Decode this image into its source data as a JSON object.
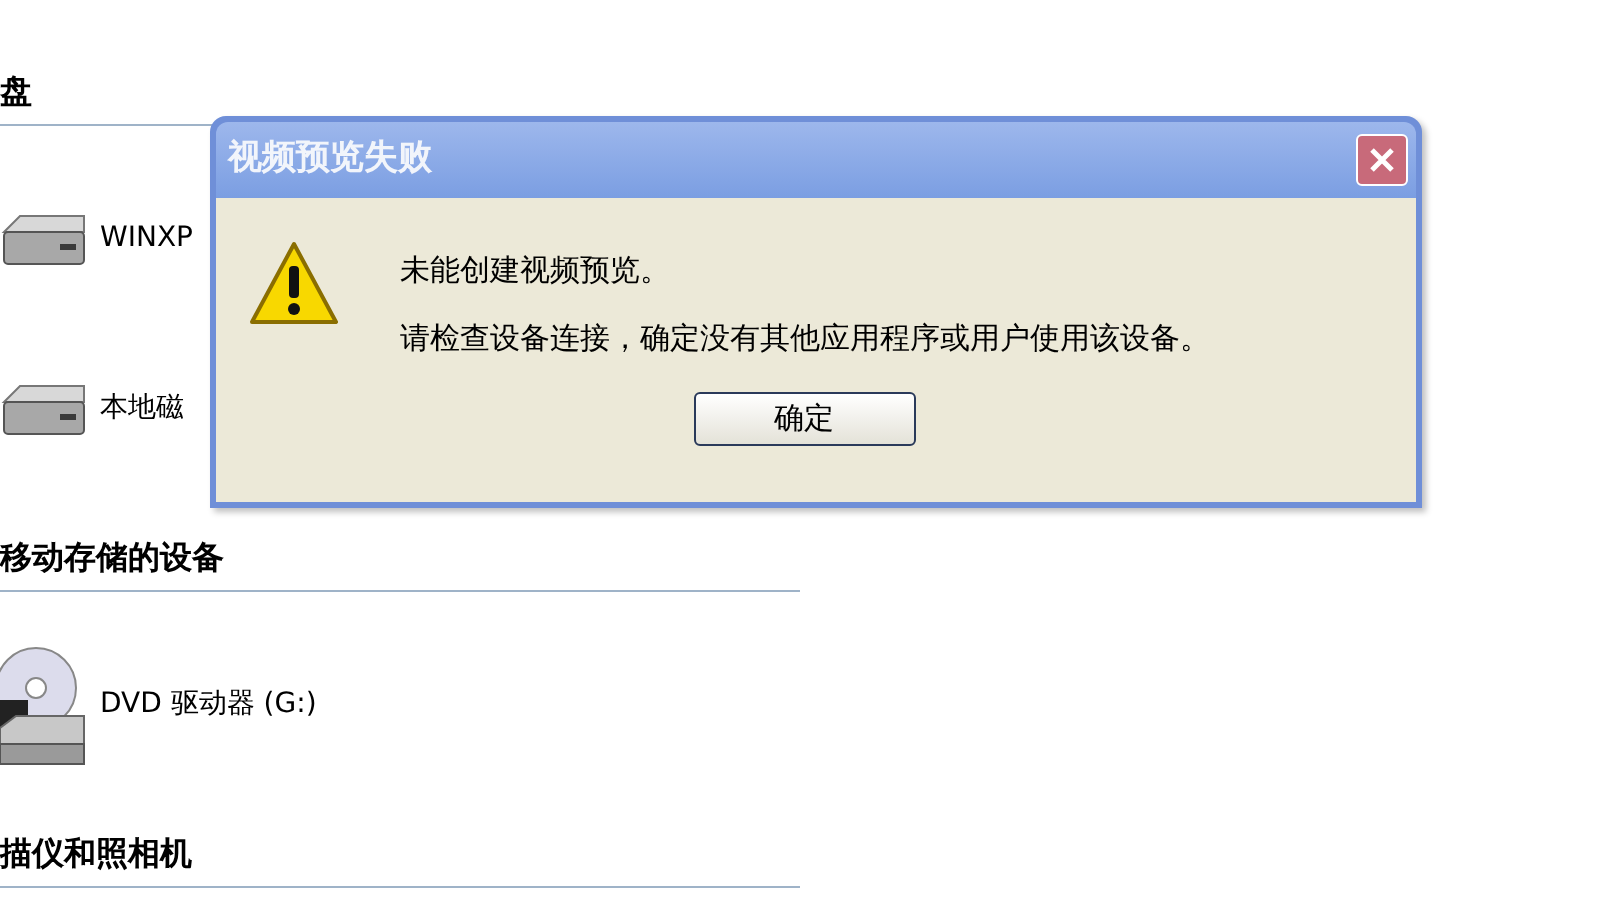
{
  "explorer": {
    "groups": [
      {
        "heading": "盘",
        "items": [
          {
            "kind": "disk",
            "label": "WINXP"
          },
          {
            "kind": "disk",
            "label": "本地磁"
          }
        ]
      },
      {
        "heading": "移动存储的设备",
        "items": [
          {
            "kind": "dvd",
            "label": "DVD 驱动器 (G:)"
          }
        ]
      },
      {
        "heading": "描仪和照相机"
      }
    ]
  },
  "dialog": {
    "title": "视频预览失败",
    "kind": "warning",
    "messages": [
      "未能创建视频预览。",
      "请检查设备连接，确定没有其他应用程序或用户使用该设备。"
    ],
    "buttons": [
      "确定"
    ]
  }
}
